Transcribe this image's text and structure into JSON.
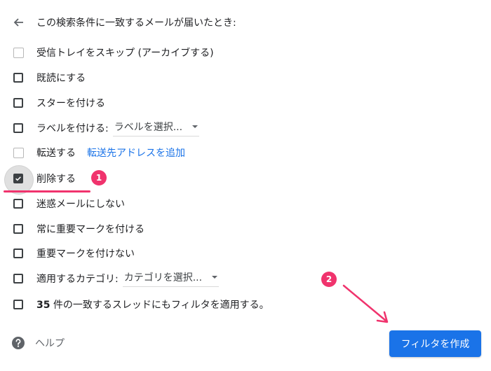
{
  "header": {
    "title": "この検索条件に一致するメールが届いたとき:"
  },
  "options": [
    {
      "label": "受信トレイをスキップ (アーカイブする)",
      "checked": false
    },
    {
      "label": "既読にする",
      "checked": false
    },
    {
      "label": "スターを付ける",
      "checked": false
    },
    {
      "label": "ラベルを付ける:",
      "checked": false,
      "dropdown": "ラベルを選択..."
    },
    {
      "label": "転送する",
      "checked": false,
      "link": "転送先アドレスを追加"
    },
    {
      "label": "削除する",
      "checked": true
    },
    {
      "label": "迷惑メールにしない",
      "checked": false
    },
    {
      "label": "常に重要マークを付ける",
      "checked": false
    },
    {
      "label": "重要マークを付けない",
      "checked": false
    },
    {
      "label": "適用するカテゴリ:",
      "checked": false,
      "dropdown": "カテゴリを選択..."
    },
    {
      "label_bold": "35",
      "label": " 件の一致するスレッドにもフィルタを適用する。",
      "checked": false
    }
  ],
  "annotations": {
    "step1": "1",
    "step2": "2",
    "color": "#f0336d"
  },
  "footer": {
    "help_label": "ヘルプ",
    "create_button": "フィルタを作成",
    "button_color": "#1a73e8"
  },
  "icons": {
    "back": "arrow-left-icon",
    "help": "help-circle-icon",
    "check": "checkmark-icon"
  }
}
